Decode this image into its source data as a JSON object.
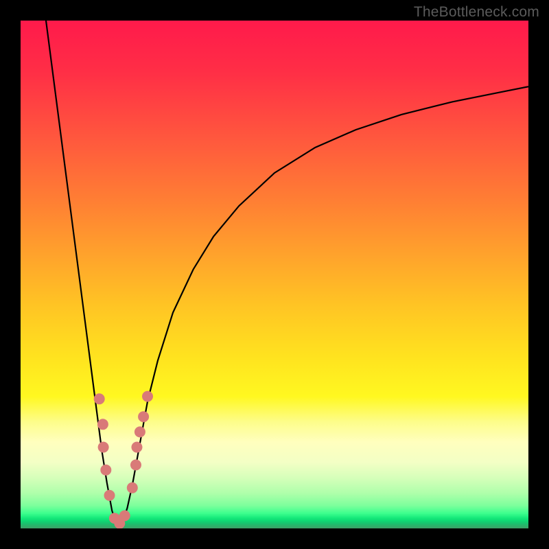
{
  "watermark": "TheBottleneck.com",
  "chart_data": {
    "type": "line",
    "title": "",
    "xlabel": "",
    "ylabel": "",
    "xlim": [
      0,
      100
    ],
    "ylim": [
      0,
      100
    ],
    "minimum_x": 19,
    "series": [
      {
        "name": "curve",
        "x": [
          5,
          6,
          7,
          8,
          9,
          10,
          11,
          12,
          13,
          14,
          15,
          16,
          17,
          18,
          19,
          20,
          21,
          22,
          23,
          24,
          25,
          27,
          30,
          34,
          38,
          43,
          50,
          58,
          66,
          75,
          85,
          95,
          100
        ],
        "y": [
          100,
          92.3,
          84.6,
          76.9,
          69.2,
          61.5,
          53.8,
          46.1,
          38.4,
          30.7,
          23.0,
          15.3,
          9.0,
          3.5,
          0.5,
          1.0,
          4.0,
          8.5,
          14.0,
          19.5,
          25.0,
          33.0,
          42.5,
          51.0,
          57.5,
          63.5,
          70.0,
          75.0,
          78.5,
          81.5,
          84.0,
          86.0,
          87.0
        ]
      }
    ],
    "markers": [
      {
        "x": 15.5,
        "y": 25.5
      },
      {
        "x": 16.2,
        "y": 20.5
      },
      {
        "x": 16.3,
        "y": 16.0
      },
      {
        "x": 16.8,
        "y": 11.5
      },
      {
        "x": 17.5,
        "y": 6.5
      },
      {
        "x": 18.5,
        "y": 2.0
      },
      {
        "x": 19.5,
        "y": 1.0
      },
      {
        "x": 20.5,
        "y": 2.5
      },
      {
        "x": 22.0,
        "y": 8.0
      },
      {
        "x": 22.7,
        "y": 12.5
      },
      {
        "x": 22.9,
        "y": 16.0
      },
      {
        "x": 23.5,
        "y": 19.0
      },
      {
        "x": 24.2,
        "y": 22.0
      },
      {
        "x": 25.0,
        "y": 26.0
      }
    ],
    "marker_color": "#d97a78",
    "curve_color": "#000000",
    "curve_width": 2.2,
    "marker_radius": 8
  }
}
